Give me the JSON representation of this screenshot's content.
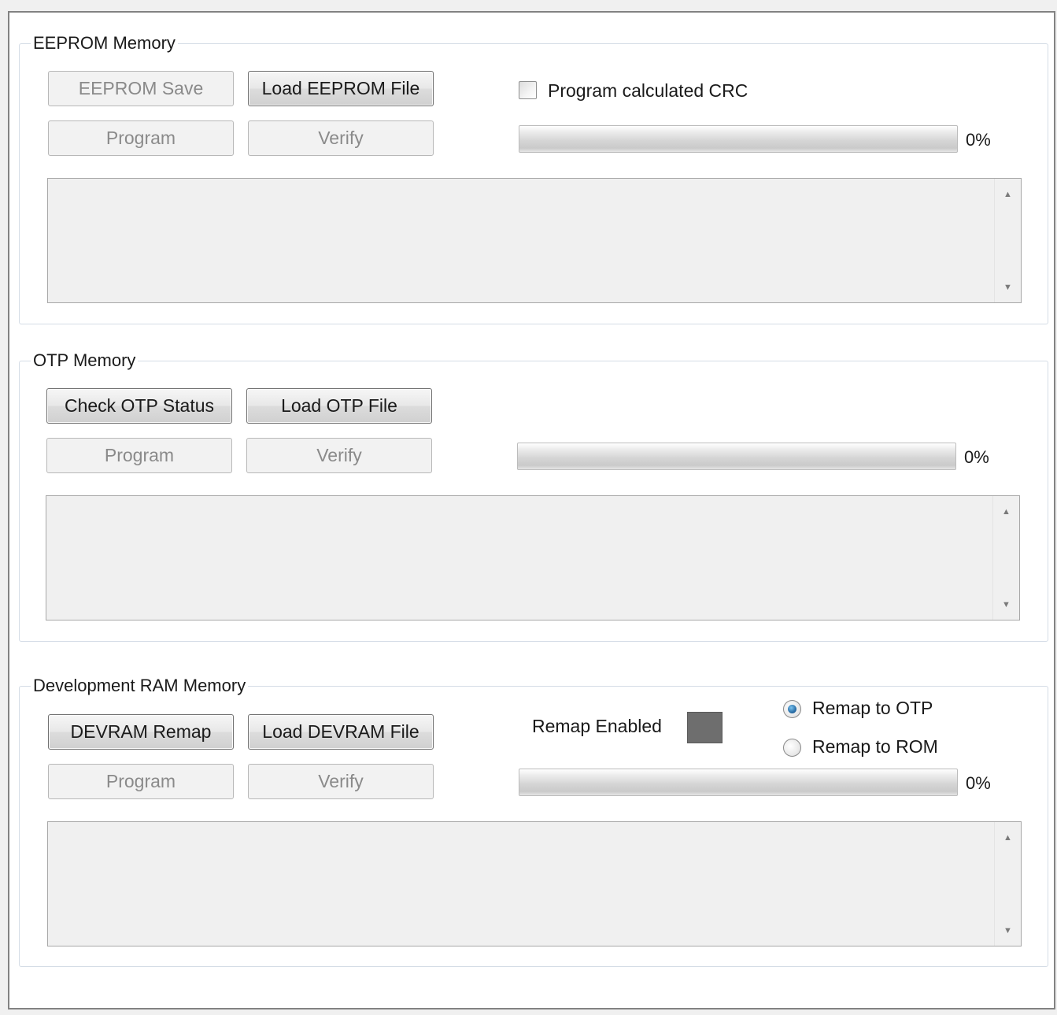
{
  "eeprom": {
    "title": "EEPROM Memory",
    "save_label": "EEPROM Save",
    "load_label": "Load EEPROM File",
    "program_label": "Program",
    "verify_label": "Verify",
    "crc_label": "Program calculated CRC",
    "crc_checked": false,
    "progress_percent": 0,
    "progress_text": "0%",
    "log_text": ""
  },
  "otp": {
    "title": "OTP Memory",
    "check_label": "Check OTP Status",
    "load_label": "Load OTP File",
    "program_label": "Program",
    "verify_label": "Verify",
    "progress_percent": 0,
    "progress_text": "0%",
    "log_text": ""
  },
  "devram": {
    "title": "Development RAM Memory",
    "remap_label": "DEVRAM Remap",
    "load_label": "Load DEVRAM File",
    "program_label": "Program",
    "verify_label": "Verify",
    "remap_enabled_label": "Remap Enabled",
    "remap_enabled_color": "#6e6e6e",
    "remap_otp_label": "Remap to OTP",
    "remap_rom_label": "Remap to ROM",
    "selected_remap": "Remap to OTP",
    "progress_percent": 0,
    "progress_text": "0%",
    "log_text": ""
  },
  "icons": {
    "scroll_up": "scroll-up-arrow-icon",
    "scroll_down": "scroll-down-arrow-icon"
  }
}
